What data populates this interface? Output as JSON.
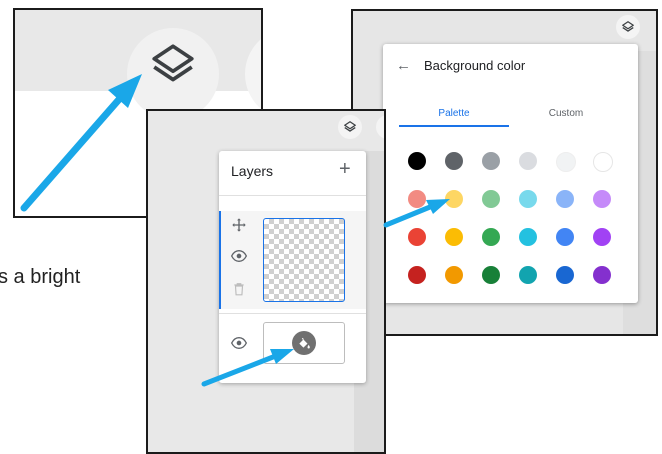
{
  "background_text": "s a bright",
  "zoom_panel": {
    "icon": "layers-icon"
  },
  "color_picker": {
    "top_icon": "layers-icon",
    "back_icon": "arrow-left-icon",
    "back_glyph": "←",
    "title": "Background color",
    "tabs": [
      {
        "label": "Palette",
        "active": true
      },
      {
        "label": "Custom",
        "active": false
      }
    ],
    "palette_rows": [
      [
        "#000000",
        "#5f6368",
        "#9aa0a6",
        "#dadce0",
        "#f1f3f4",
        "#ffffff"
      ],
      [
        "#f28b82",
        "#fdd663",
        "#81c995",
        "#78d9ec",
        "#8ab4f8",
        "#c58af9"
      ],
      [
        "#ea4335",
        "#fbbc04",
        "#34a853",
        "#24c1e0",
        "#4285f4",
        "#a142f4"
      ],
      [
        "#c5221f",
        "#f29900",
        "#188038",
        "#12a4af",
        "#1967d2",
        "#8430ce"
      ]
    ]
  },
  "layers_panel": {
    "top_icon": "layers-icon",
    "title": "Layers",
    "add_glyph": "+",
    "layers": [
      {
        "name": "drawing-layer",
        "selected": true,
        "icons": [
          "move-icon",
          "eye-icon",
          "trash-icon"
        ]
      },
      {
        "name": "background-layer",
        "selected": false,
        "icons": [
          "eye-icon",
          "paint-bucket-icon"
        ]
      }
    ]
  },
  "annotation_color": "#1aa7e8",
  "accent_color": "#1a73e8"
}
